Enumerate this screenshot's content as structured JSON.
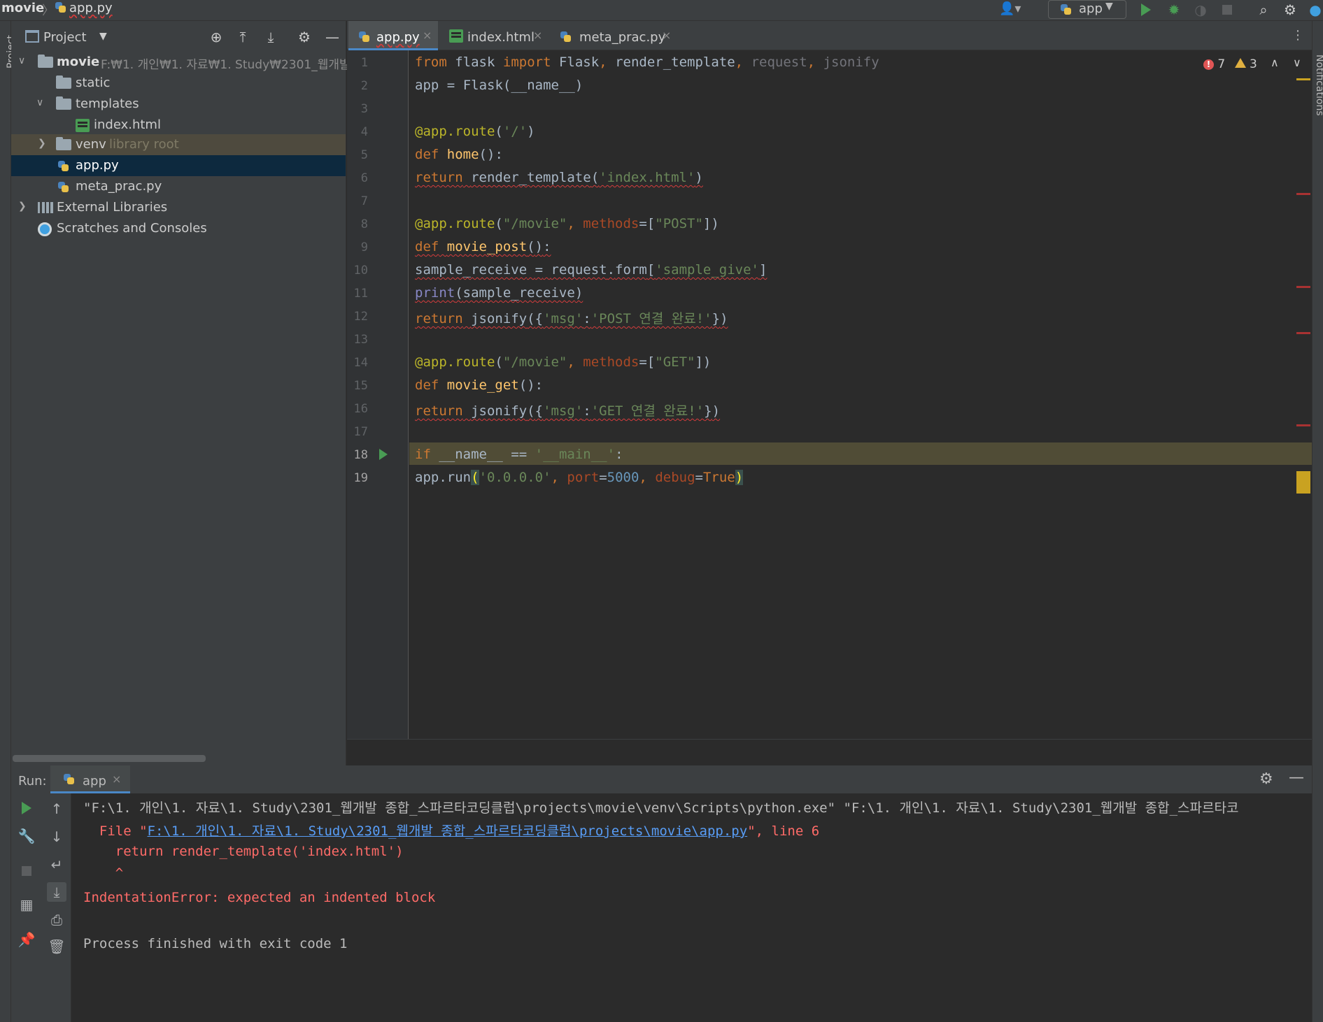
{
  "breadcrumb": {
    "project": "movie",
    "separator": "〉",
    "file": "app.py"
  },
  "toolbar": {
    "run_config": "app",
    "icons": [
      "user-icon",
      "run-icon",
      "debug-icon",
      "coverage-icon",
      "stop-icon",
      "search-icon",
      "settings-icon",
      "update-icon"
    ]
  },
  "side_strips": {
    "left": "Project",
    "right": "Notifications"
  },
  "project_panel": {
    "title": "Project",
    "tree": [
      {
        "label": "movie",
        "hint": "F:₩1. 개인₩1. 자료₩1. Study₩2301_웹개발",
        "type": "folder",
        "expanded": true
      },
      {
        "label": "static",
        "type": "folder"
      },
      {
        "label": "templates",
        "type": "folder",
        "expanded": true
      },
      {
        "label": "index.html",
        "type": "html"
      },
      {
        "label": "venv",
        "hint": "library root",
        "type": "folder",
        "expanded": false
      },
      {
        "label": "app.py",
        "type": "python",
        "selected": true
      },
      {
        "label": "meta_prac.py",
        "type": "python"
      },
      {
        "label": "External Libraries",
        "type": "libraries"
      },
      {
        "label": "Scratches and Consoles",
        "type": "scratches"
      }
    ]
  },
  "editor": {
    "tabs": [
      {
        "label": "app.py",
        "active": true
      },
      {
        "label": "index.html"
      },
      {
        "label": "meta_prac.py"
      }
    ],
    "close_glyph": "×",
    "inspections": {
      "errors": "7",
      "warnings": "3"
    },
    "line_numbers": [
      "1",
      "2",
      "3",
      "4",
      "5",
      "6",
      "7",
      "8",
      "9",
      "10",
      "11",
      "12",
      "13",
      "14",
      "15",
      "16",
      "17",
      "18",
      "19"
    ],
    "current_line": "19",
    "code": [
      "from flask import Flask, render_template, request, jsonify",
      "app = Flask(__name__)",
      "",
      "@app.route('/')",
      "def home():",
      "return render_template('index.html')",
      "",
      "@app.route(\"/movie\", methods=[\"POST\"])",
      "def movie_post():",
      "sample_receive = request.form['sample_give']",
      "print(sample_receive)",
      "return jsonify({'msg':'POST 연결 완료!'})",
      "",
      "@app.route(\"/movie\", methods=[\"GET\"])",
      "def movie_get():",
      "return jsonify({'msg':'GET 연결 완료!'})",
      "",
      "if __name__ == '__main__':",
      "app.run('0.0.0.0', port=5000, debug=True)"
    ]
  },
  "run_window": {
    "label": "Run:",
    "tab": "app",
    "console": {
      "command": "\"F:\\1. 개인\\1. 자료\\1. Study\\2301_웹개발 종합_스파르타코딩클럽\\projects\\movie\\venv\\Scripts\\python.exe\" \"F:\\1. 개인\\1. 자료\\1. Study\\2301_웹개발 종합_스파르타코",
      "file_prefix": "  File \"",
      "file_link": "F:\\1. 개인\\1. 자료\\1. Study\\2301_웹개발 종합_스파르타코딩클럽\\projects\\movie\\app.py",
      "file_suffix": "\", line 6",
      "source_line": "    return render_template('index.html')",
      "caret": "    ^",
      "error": "IndentationError: expected an indented block",
      "exit": "Process finished with exit code 1"
    }
  },
  "colors": {
    "keyword": "#cc7832",
    "string": "#6a8759",
    "number": "#6897bb",
    "decorator": "#bbb529",
    "function": "#ffc66d",
    "error_text": "#ff6b68",
    "link": "#589df6",
    "selection": "#0d293e"
  }
}
